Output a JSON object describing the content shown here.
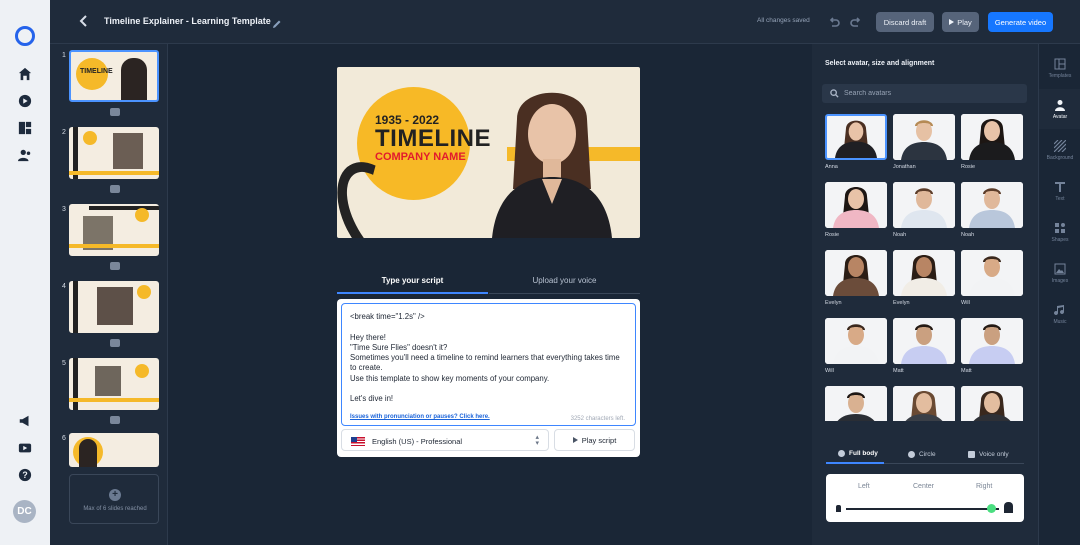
{
  "header": {
    "title": "Timeline Explainer - Learning Template",
    "saved_status": "All changes saved",
    "discard_label": "Discard draft",
    "play_label": "Play",
    "generate_label": "Generate video"
  },
  "user": {
    "initials": "DC"
  },
  "slides": {
    "items": [
      {
        "number": "1"
      },
      {
        "number": "2"
      },
      {
        "number": "3"
      },
      {
        "number": "4"
      },
      {
        "number": "5"
      },
      {
        "number": "6"
      }
    ],
    "max_label": "Max of 6 slides reached"
  },
  "stage": {
    "years": "1935 - 2022",
    "headline": "TIMELINE",
    "company": "COMPANY NAME"
  },
  "script": {
    "tabs": [
      "Type your script",
      "Upload your voice"
    ],
    "text": "<break time=\"1.2s\" />\n\nHey there!\n\"Time Sure Flies\" doesn't it?\nSometimes you'll need a timeline to remind learners that everything takes time to create.\nUse this template to show key moments of your company.\n\nLet's dive in!",
    "issues_link": "Issues with pronunciation or pauses? Click here.",
    "chars_left": "3252 characters left.",
    "voice": "English (US) - Professional",
    "play_script_label": "Play script"
  },
  "avatar_panel": {
    "title": "Select avatar, size and alignment",
    "search_placeholder": "Search avatars",
    "avatars": [
      {
        "name": "Anna",
        "gender": "f",
        "outfit": "#1f1f24",
        "skin": "#e8c3a8",
        "hair": "#4a2f22"
      },
      {
        "name": "Jonathan",
        "gender": "m",
        "outfit": "#2c3440",
        "skin": "#e6c1a4",
        "hair": "#b58a55"
      },
      {
        "name": "Rosie",
        "gender": "f",
        "outfit": "#1b1b1d",
        "skin": "#e8c3a8",
        "hair": "#1d1613"
      },
      {
        "name": "Rosie",
        "gender": "f",
        "outfit": "#f0b7c4",
        "skin": "#e8c3a8",
        "hair": "#1d1613"
      },
      {
        "name": "Noah",
        "gender": "m",
        "outfit": "#dfe6ef",
        "skin": "#e0b89a",
        "hair": "#5c3d2a"
      },
      {
        "name": "Noah",
        "gender": "m",
        "outfit": "#b9c7db",
        "skin": "#e0b89a",
        "hair": "#5c3d2a"
      },
      {
        "name": "Evelyn",
        "gender": "f",
        "outfit": "#6b4c3a",
        "skin": "#b88564",
        "hair": "#2b1d15"
      },
      {
        "name": "Evelyn",
        "gender": "f",
        "outfit": "#f1ede6",
        "skin": "#b88564",
        "hair": "#2b1d15"
      },
      {
        "name": "Will",
        "gender": "m",
        "outfit": "#f2f3f5",
        "skin": "#d8aa87",
        "hair": "#3a281d"
      },
      {
        "name": "Will",
        "gender": "m",
        "outfit": "#f2f3f5",
        "skin": "#d8aa87",
        "hair": "#3a281d"
      },
      {
        "name": "Matt",
        "gender": "m",
        "outfit": "#c7cdf2",
        "skin": "#caa080",
        "hair": "#241a14"
      },
      {
        "name": "Matt",
        "gender": "m",
        "outfit": "#c7cdf2",
        "skin": "#caa080",
        "hair": "#241a14"
      },
      {
        "name": "",
        "gender": "m",
        "outfit": "#2a2e35",
        "skin": "#d9b191",
        "hair": "#1d1613"
      },
      {
        "name": "",
        "gender": "f",
        "outfit": "#3a3f47",
        "skin": "#e3bd9f",
        "hair": "#6a4a33"
      },
      {
        "name": "",
        "gender": "f",
        "outfit": "#2e3036",
        "skin": "#e3bd9f",
        "hair": "#3a281d"
      }
    ],
    "selected_index": 0,
    "shape_tabs": [
      "Full body",
      "Circle",
      "Voice only"
    ],
    "alignment": [
      "Left",
      "Center",
      "Right"
    ],
    "size_fraction": 0.95
  },
  "tools": [
    {
      "label": "Templates",
      "icon": "layout-icon"
    },
    {
      "label": "Avatar",
      "icon": "person-icon"
    },
    {
      "label": "Background",
      "icon": "hatch-icon"
    },
    {
      "label": "Text",
      "icon": "text-icon"
    },
    {
      "label": "Shapes",
      "icon": "shapes-icon"
    },
    {
      "label": "Images",
      "icon": "image-icon"
    },
    {
      "label": "Music",
      "icon": "music-icon"
    }
  ],
  "colors": {
    "accent": "#1677ff",
    "brand_yellow": "#f7b926",
    "brand_red": "#e21b2d"
  }
}
